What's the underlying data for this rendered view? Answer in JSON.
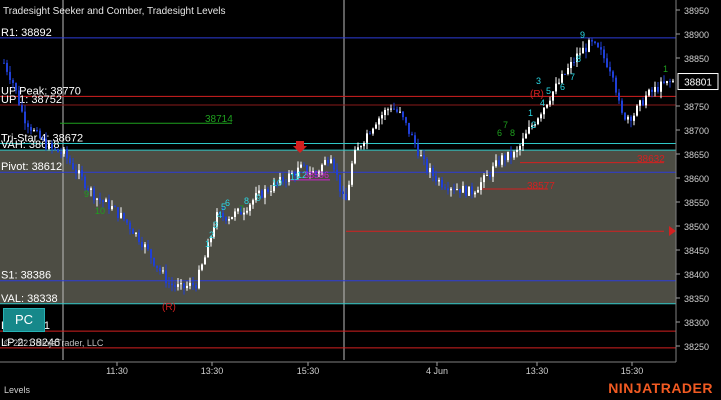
{
  "window": {
    "title": "Tradesight Seeker and Comber, Tradesight Levels",
    "footer_label": "Levels",
    "copyright": "© 2021 NinjaTrader, LLC",
    "brand": "NINJATRADER",
    "pc_button": "PC"
  },
  "colors": {
    "background": "#000000",
    "band_fill": "#5b5a50",
    "up_bar": "#ffffff",
    "down_bar": "#1f3fd6",
    "r1_line": "#2c3cd8",
    "pivot_line": "#2c3cd8",
    "val_line": "#2fc8c8",
    "vah_line": "#2fc8c8",
    "red_line": "#d42020",
    "brand": "#f15a22"
  },
  "chart_data": {
    "type": "candlestick",
    "instrument_price_range": [
      38225,
      38975
    ],
    "last_price": 38801,
    "price_axis_ticks": [
      38950,
      38900,
      38850,
      38801,
      38750,
      38700,
      38650,
      38600,
      38550,
      38500,
      38450,
      38400,
      38350,
      38300,
      38250
    ],
    "time_axis_ticks": [
      "11:30",
      "13:30",
      "15:30",
      "4 Jun",
      "13:30",
      "15:30"
    ],
    "levels": [
      {
        "name": "R1",
        "label": "R1: 38892",
        "price": 38892,
        "color": "#2c3cd8"
      },
      {
        "name": "UP peak",
        "label": "UP Peak: 38770",
        "price": 38770,
        "color": "#d42020"
      },
      {
        "name": "UP 1",
        "label": "UP 1: 38752",
        "price": 38752,
        "color": "#8a1a1a"
      },
      {
        "name": "Tri-Star",
        "label": "Tri-Star 4: 38672",
        "price": 38672,
        "color": "#2fc8c8"
      },
      {
        "name": "VAH",
        "label": "VAH: 38658",
        "price": 38658,
        "color": "#2fc8c8"
      },
      {
        "name": "Pivot",
        "label": "Pivot: 38612",
        "price": 38612,
        "color": "#2c3cd8"
      },
      {
        "name": "S1",
        "label": "S1: 38386",
        "price": 38386,
        "color": "#2c3cd8"
      },
      {
        "name": "VAL",
        "label": "VAL: 38338",
        "price": 38338,
        "color": "#2fc8c8"
      },
      {
        "name": "L1",
        "label": "L1: 38281",
        "price": 38281,
        "color": "#d42020"
      },
      {
        "name": "LP",
        "label": "LP 2: 38246",
        "price": 38246,
        "color": "#d42020"
      }
    ],
    "annotations": [
      {
        "text": "38714",
        "color": "#1ea01e"
      },
      {
        "text": "38596",
        "color": "#d020d0"
      },
      {
        "text": "38632",
        "color": "#d42020"
      },
      {
        "text": "38577",
        "color": "#d42020"
      },
      {
        "text": "(R)",
        "color": "#d42020"
      },
      {
        "text": "(R)",
        "color": "#d42020"
      }
    ]
  }
}
